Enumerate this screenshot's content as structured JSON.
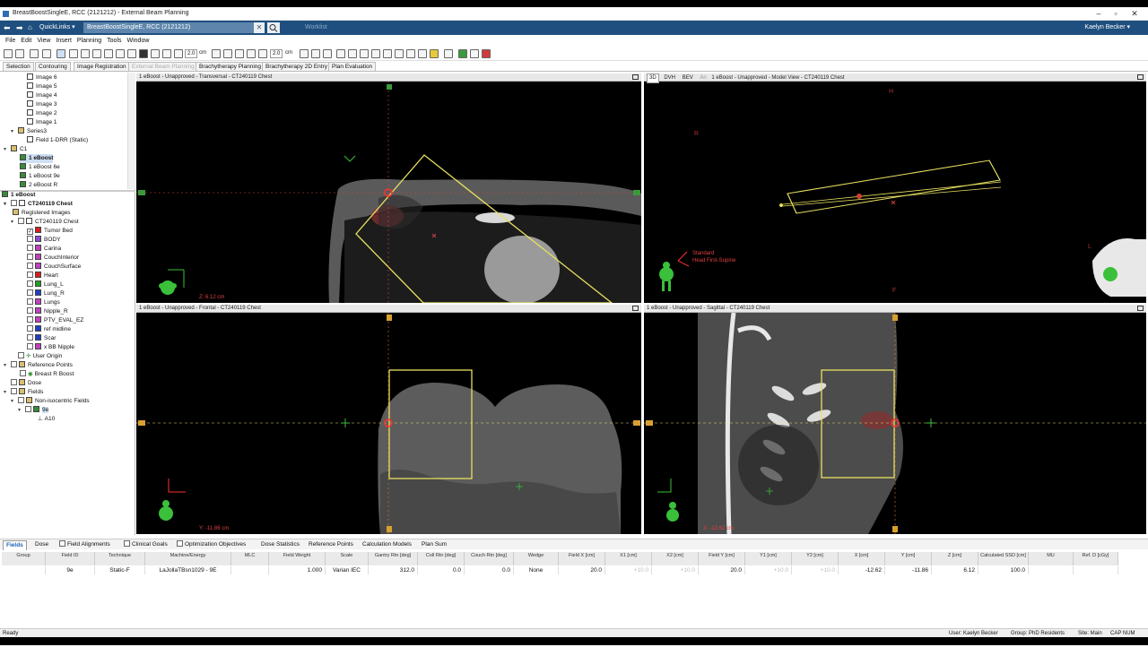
{
  "window": {
    "title": "BreastBoostSingleE, RCC (2121212) - External Beam Planning"
  },
  "quickbar": {
    "quicklinks": "QuickLinks ▾",
    "patient": "BreastBoostSingleE, RCC (2121212)",
    "worklist": "Worklist",
    "user": "Kaelyn Becker ▾"
  },
  "menu": [
    "File",
    "Edit",
    "View",
    "Insert",
    "Planning",
    "Tools",
    "Window"
  ],
  "toolbar": {
    "zoom1": "2.0",
    "unit1": "cm",
    "zoom2": "2.0",
    "unit2": "cm"
  },
  "workspace_tabs": [
    {
      "label": "Selection",
      "disabled": false
    },
    {
      "label": "Contouring",
      "disabled": false
    },
    {
      "label": "Image Registration",
      "disabled": false
    },
    {
      "label": "External Beam Planning",
      "disabled": true
    },
    {
      "label": "Brachytherapy Planning",
      "disabled": false
    },
    {
      "label": "Brachytherapy 2D Entry",
      "disabled": false
    },
    {
      "label": "Plan Evaluation",
      "disabled": false
    }
  ],
  "tree_top": [
    "Image 6",
    "Image 5",
    "Image 4",
    "Image 3",
    "Image 2",
    "Image 1",
    "Series3",
    "Field 1-DRR (Static)",
    "C1",
    "1 eBoost",
    "1 eBoost 6e",
    "1 eBoost 9e",
    "2 eBoost R"
  ],
  "tree_bottom": {
    "plan": "1 eBoost",
    "image": "CT240119 Chest",
    "registered": "Registered Images",
    "image2": "CT240119 Chest",
    "structures": [
      {
        "name": "Tumor Bed",
        "color": "#d42020",
        "checked": true
      },
      {
        "name": "BODY",
        "color": "#8a4ccf",
        "checked": false
      },
      {
        "name": "Carina",
        "color": "#c040c0",
        "checked": false
      },
      {
        "name": "CouchInterior",
        "color": "#c040c0",
        "checked": false
      },
      {
        "name": "CouchSurface",
        "color": "#c040c0",
        "checked": false
      },
      {
        "name": "Heart",
        "color": "#d42020",
        "checked": false
      },
      {
        "name": "Lung_L",
        "color": "#20a020",
        "checked": false
      },
      {
        "name": "Lung_R",
        "color": "#2040c0",
        "checked": false
      },
      {
        "name": "Lungs",
        "color": "#c040c0",
        "checked": false
      },
      {
        "name": "Nipple_R",
        "color": "#c040c0",
        "checked": false
      },
      {
        "name": "PTV_EVAL_EZ",
        "color": "#c040c0",
        "checked": false
      },
      {
        "name": "ref midline",
        "color": "#2040c0",
        "checked": false
      },
      {
        "name": "Scar",
        "color": "#2040c0",
        "checked": false
      },
      {
        "name": "x BB Nipple",
        "color": "#c040c0",
        "checked": false
      }
    ],
    "user_origin": "User Origin",
    "ref_points": "Reference Points",
    "ref_point": "Breast R Boost",
    "dose": "Dose",
    "fields": "Fields",
    "noniso": "Non-isocentric Fields",
    "field": "9e",
    "applicator": "A10"
  },
  "viewports": {
    "transversal": {
      "title": "1 eBoost - Unapproved - Transversal - CT240119 Chest",
      "z": "Z: 6.12 cm"
    },
    "model": {
      "title": "1 eBoost - Unapproved - Model View - CT240119 Chest",
      "tabs": [
        "3D",
        "DVH",
        "BEV",
        "An"
      ],
      "orient1": "Standard",
      "orient2": "Head First-Supine",
      "h": "H",
      "f": "F",
      "r": "R",
      "l": "L"
    },
    "frontal": {
      "title": "1 eBoost - Unapproved - Frontal - CT240119 Chest",
      "y": "Y: -11.86 cm"
    },
    "sagittal": {
      "title": "1 eBoost - Unapproved - Sagittal - CT240119 Chest",
      "x": "X: -12.62 cm"
    }
  },
  "bottom_tabs": [
    "Fields",
    "Dose",
    "Field Alignments",
    "Clinical Goals",
    "Optimization Objectives",
    "Dose Statistics",
    "Reference Points",
    "Calculation Models",
    "Plan Sum"
  ],
  "fields_table": {
    "headers": [
      "Group",
      "Field ID",
      "Technique",
      "Machine/Energy",
      "MLC",
      "Field Weight",
      "Scale",
      "Gantry Rtn [deg]",
      "Coll Rtn [deg]",
      "Couch Rtn [deg]",
      "Wedge",
      "Field X [cm]",
      "X1 [cm]",
      "X2 [cm]",
      "Field Y [cm]",
      "Y1 [cm]",
      "Y2 [cm]",
      "X [cm]",
      "Y [cm]",
      "Z [cm]",
      "Calculated SSD [cm]",
      "MU",
      "Ref. D [cGy]"
    ],
    "row": [
      "",
      "9e",
      "Static-F",
      "LaJollaTBsn1029 - 9E",
      "",
      "1.000",
      "Varian IEC",
      "312.0",
      "0.0",
      "0.0",
      "None",
      "20.0",
      "+10.0",
      "+10.0",
      "20.0",
      "+10.0",
      "+10.0",
      "-12.62",
      "-11.86",
      "6.12",
      "100.0",
      "",
      ""
    ]
  },
  "status": {
    "left": "Ready",
    "user": "User: Kaelyn Becker",
    "group": "Group: PhD Residents",
    "site": "Site: Main",
    "keys": "CAP NUM SCRL"
  }
}
